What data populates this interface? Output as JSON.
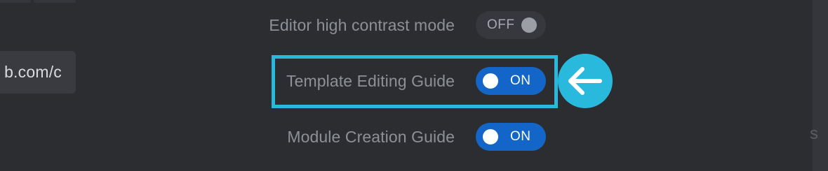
{
  "url_field": {
    "value": "b.com/c"
  },
  "settings": [
    {
      "label": "Editor high contrast mode",
      "state": "OFF"
    },
    {
      "label": "Template Editing Guide",
      "state": "ON"
    },
    {
      "label": "Module Creation Guide",
      "state": "ON"
    }
  ],
  "right_edge_text": "s",
  "annotation": {
    "icon": "arrow-left-icon",
    "color": "#29b9dc"
  },
  "colors": {
    "background": "#2c2d31",
    "toggle_on": "#1366c8",
    "toggle_off": "#37383d",
    "highlight": "#29b9dc"
  }
}
